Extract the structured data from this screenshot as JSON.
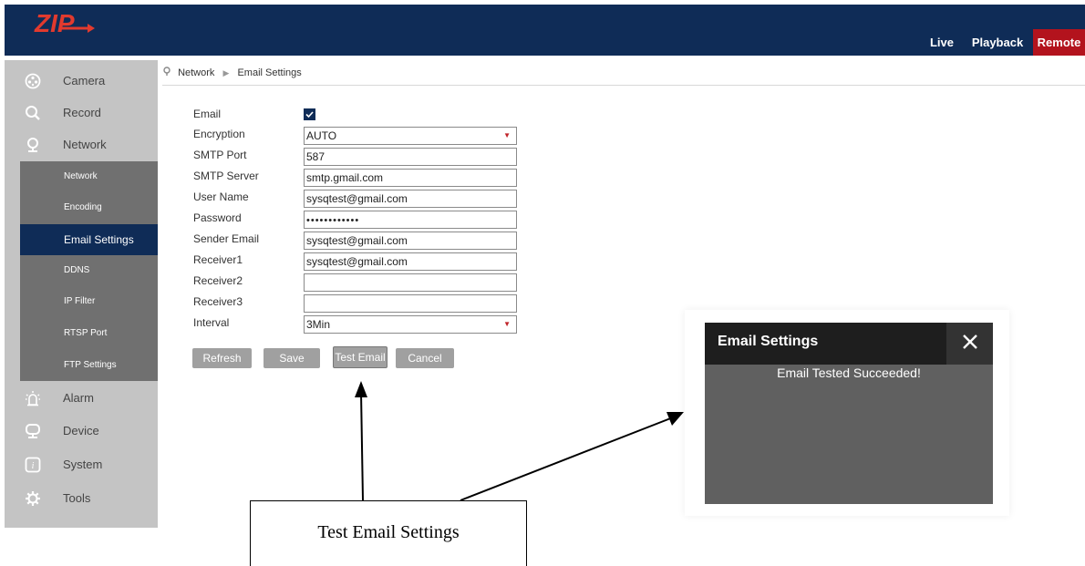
{
  "header": {
    "logo_text": "ZIP",
    "nav": [
      "Live",
      "Playback",
      "Remote"
    ]
  },
  "colors": {
    "header_bg": "#0f2c57",
    "remote_active": "#b3131d",
    "sidebar_bg": "#c4c4c4",
    "submenu_bg": "#707070",
    "submenu_active": "#0f2c57",
    "button_bg": "#a0a0a0",
    "dialog_bg": "#606060",
    "dialog_header": "#1e1e1e"
  },
  "sidebar": {
    "main_items": [
      {
        "label": "Camera",
        "icon": "camera-icon"
      },
      {
        "label": "Record",
        "icon": "search-icon"
      },
      {
        "label": "Network",
        "icon": "location-pin-icon"
      },
      {
        "label": "Alarm",
        "icon": "alarm-icon"
      },
      {
        "label": "Device",
        "icon": "monitor-icon"
      },
      {
        "label": "System",
        "icon": "info-icon"
      },
      {
        "label": "Tools",
        "icon": "gear-icon"
      }
    ],
    "network_submenu": [
      "Network",
      "Encoding",
      "Email Settings",
      "DDNS",
      "IP Filter",
      "RTSP Port",
      "FTP Settings"
    ],
    "active_submenu": "Email Settings"
  },
  "breadcrumb": {
    "section": "Network",
    "page": "Email Settings"
  },
  "form": {
    "email_label": "Email",
    "email_checked": true,
    "encryption": {
      "label": "Encryption",
      "value": "AUTO"
    },
    "smtp_port": {
      "label": "SMTP Port",
      "value": "587"
    },
    "smtp_server": {
      "label": "SMTP Server",
      "value": "smtp.gmail.com"
    },
    "user_name": {
      "label": "User Name",
      "value": "sysqtest@gmail.com"
    },
    "password": {
      "label": "Password",
      "value": "••••••••••••"
    },
    "sender_email": {
      "label": "Sender Email",
      "value": "sysqtest@gmail.com"
    },
    "receiver1": {
      "label": "Receiver1",
      "value": "sysqtest@gmail.com"
    },
    "receiver2": {
      "label": "Receiver2",
      "value": ""
    },
    "receiver3": {
      "label": "Receiver3",
      "value": ""
    },
    "interval": {
      "label": "Interval",
      "value": "3Min"
    }
  },
  "buttons": {
    "refresh": "Refresh",
    "save": "Save",
    "test_email": "Test Email",
    "cancel": "Cancel"
  },
  "dialog": {
    "title": "Email Settings",
    "close": "×",
    "message": "Email Tested Succeeded!"
  },
  "callout": {
    "text": "Test Email Settings"
  }
}
